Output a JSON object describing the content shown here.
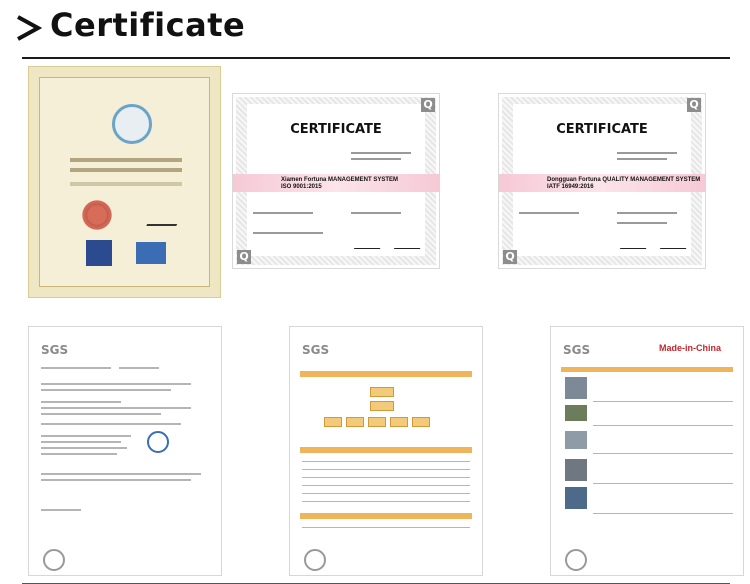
{
  "header": {
    "title": "Certificate",
    "icon": "chevron-right-icon"
  },
  "certificates": {
    "qa_left": {
      "heading": "CERTIFICATE",
      "company": "Xiamen Fortuna",
      "system": "MANAGEMENT SYSTEM",
      "standard": "ISO 9001:2015"
    },
    "qa_right": {
      "heading": "CERTIFICATE",
      "company": "Dongguan Fortuna",
      "system": "QUALITY MANAGEMENT SYSTEM",
      "standard": "IATF 16949:2016"
    }
  },
  "sgs_reports": {
    "logo": "SGS",
    "marketplace": "Made-in-China"
  },
  "colors": {
    "heading": "#111111",
    "band": "#f6c9d6",
    "sgs_accent": "#f0b45a",
    "mic_red": "#c0272d"
  }
}
